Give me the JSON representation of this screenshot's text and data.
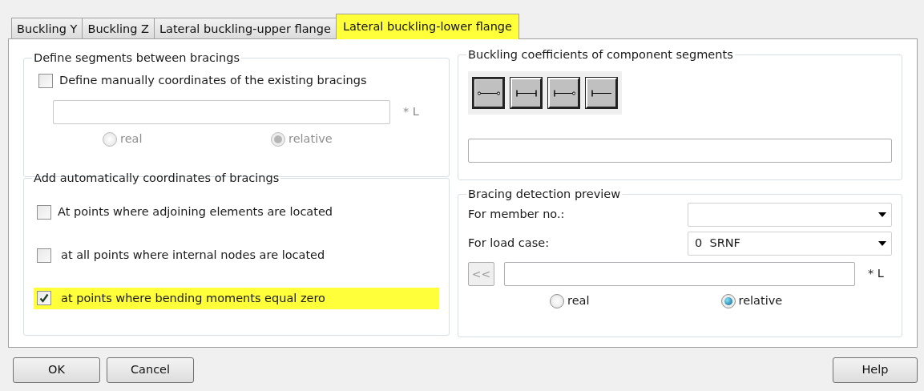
{
  "tabs": [
    {
      "label": "Buckling Y",
      "selected": false,
      "highlighted": false
    },
    {
      "label": "Buckling Z",
      "selected": false,
      "highlighted": false
    },
    {
      "label": "Lateral buckling-upper flange",
      "selected": false,
      "highlighted": false
    },
    {
      "label": "Lateral buckling-lower flange",
      "selected": true,
      "highlighted": true
    }
  ],
  "segments_group": {
    "title": "Define segments between bracings",
    "manual": {
      "label": "Define manually coordinates of the existing bracings",
      "checked": false
    },
    "coordinates_field": {
      "suffix": "* L",
      "disabled": true
    },
    "radios": [
      {
        "label": "real",
        "selected": false,
        "disabled": true
      },
      {
        "label": "relative",
        "selected": true,
        "disabled": true
      }
    ]
  },
  "auto_group": {
    "title": "Add automatically coordinates of bracings",
    "options": [
      {
        "label": "At points where adjoining elements are located",
        "checked": false,
        "highlighted": false
      },
      {
        "label": "at all points where internal nodes are located",
        "checked": false,
        "highlighted": false
      },
      {
        "label": "at points where bending moments equal zero",
        "checked": true,
        "highlighted": true
      }
    ]
  },
  "coefficients_group": {
    "title": "Buckling coefficients of component segments",
    "tool_buttons": [
      {
        "kind": "hinged-hinged",
        "selected": true
      },
      {
        "kind": "fixed-fixed",
        "selected": false
      },
      {
        "kind": "fixed-hinged",
        "selected": false
      },
      {
        "kind": "fixed-free",
        "selected": false
      }
    ]
  },
  "preview_group": {
    "title": "Bracing detection preview",
    "rows": [
      {
        "label": "For member no.:"
      },
      {
        "label": "For load case:",
        "value": "0  SRNF"
      }
    ],
    "back_button": {
      "label": "<<",
      "disabled": true
    },
    "suffix": "* L",
    "radios": [
      {
        "label": "real",
        "selected": false,
        "disabled": false
      },
      {
        "label": "relative",
        "selected": true,
        "disabled": false
      }
    ]
  },
  "buttons": [
    {
      "label": "OK"
    },
    {
      "label": "Cancel"
    },
    {
      "label": "Help"
    }
  ]
}
